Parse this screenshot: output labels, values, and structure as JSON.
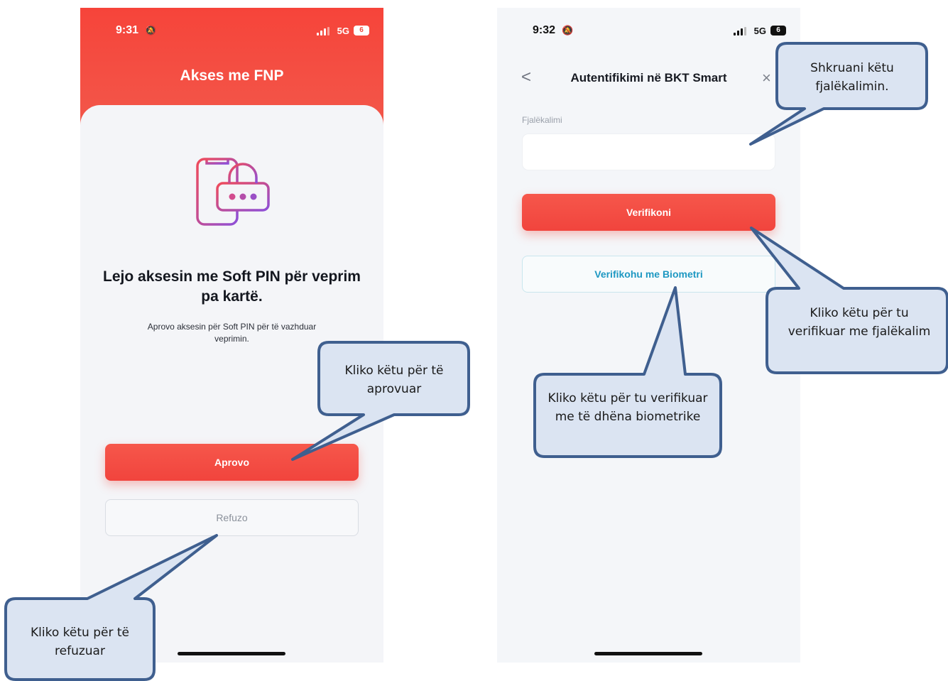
{
  "phone1": {
    "status": {
      "time": "9:31",
      "network": "5G",
      "battery": "6"
    },
    "title": "Akses me FNP",
    "heading": "Lejo aksesin me Soft PIN për veprim pa kartë.",
    "subtext": "Aprovo aksesin për Soft PIN për të vazhduar veprimin.",
    "approve_label": "Aprovo",
    "reject_label": "Refuzo"
  },
  "phone2": {
    "status": {
      "time": "9:32",
      "network": "5G",
      "battery": "6"
    },
    "back": "<",
    "title": "Autentifikimi në BKT Smart",
    "close": "×",
    "password_label": "Fjalëkalimi",
    "password_value": "",
    "verify_label": "Verifikoni",
    "biometric_label": "Verifikohu me Biometri"
  },
  "callouts": {
    "approve": "Kliko këtu për të aprovuar",
    "reject": "Kliko këtu për të refuzuar",
    "password": "Shkruani këtu fjalëkalimin.",
    "verify_password": "Kliko këtu për tu verifikuar me fjalëkalim",
    "verify_biometric": "Kliko këtu për tu verifikuar me të dhëna biometrike"
  },
  "colors": {
    "primary_red": "#f34a40",
    "biometric_blue": "#1e98c2",
    "callout_fill": "#dbe4f2",
    "callout_stroke": "#3f5f8f"
  },
  "icons": {
    "lock": "phone-lock-icon",
    "eye": "eye-icon",
    "bell": "bell-slash-icon"
  }
}
